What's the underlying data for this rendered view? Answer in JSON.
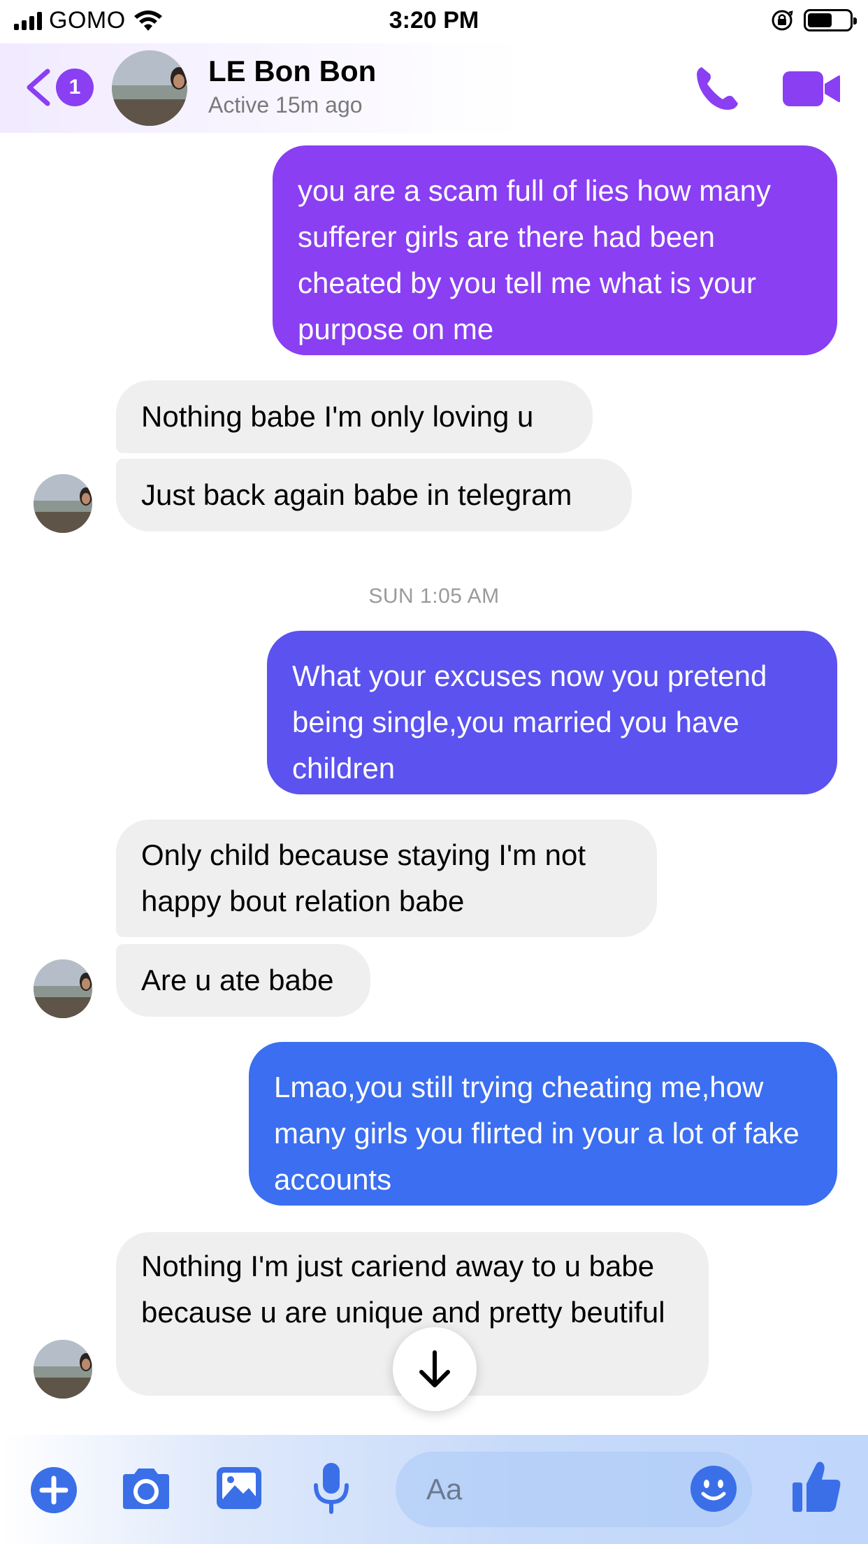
{
  "status_bar": {
    "carrier": "GOMO",
    "time": "3:20 PM"
  },
  "header": {
    "back_badge_count": "1",
    "contact_name": "LE Bon Bon",
    "contact_status": "Active 15m ago"
  },
  "messages": [
    {
      "side": "out",
      "text": "you are a scam full of lies how many sufferer girls are there had been cheated by you tell me what is your purpose on me"
    },
    {
      "side": "in",
      "text": "Nothing babe I'm only loving u"
    },
    {
      "side": "in",
      "text": "Just back again babe in telegram"
    },
    {
      "side": "out",
      "text": "What your excuses now you pretend being single,you married you have children"
    },
    {
      "side": "in",
      "text": "Only child because staying I'm not happy bout relation babe"
    },
    {
      "side": "in",
      "text": "Are u ate babe"
    },
    {
      "side": "out",
      "text": "Lmao,you still trying cheating me,how many girls you flirted in your a lot of fake accounts"
    },
    {
      "side": "in",
      "text": "Nothing I'm just cariend away to u babe because u are unique and pretty beutiful"
    }
  ],
  "timestamp": "SUN 1:05 AM",
  "composer": {
    "placeholder": "Aa"
  },
  "colors": {
    "accent_purple": "#8a3ff2",
    "bubble_1": "#8a3ff2",
    "bubble_2": "#5b52ef",
    "bubble_3": "#3b6ef0",
    "incoming_bubble": "#efefef",
    "composer_blue": "#3a6fe8"
  },
  "icons": [
    "back-chevron-icon",
    "phone-icon",
    "video-camera-icon",
    "plus-icon",
    "camera-icon",
    "gallery-icon",
    "microphone-icon",
    "emoji-icon",
    "thumbs-up-icon",
    "arrow-down-icon"
  ]
}
